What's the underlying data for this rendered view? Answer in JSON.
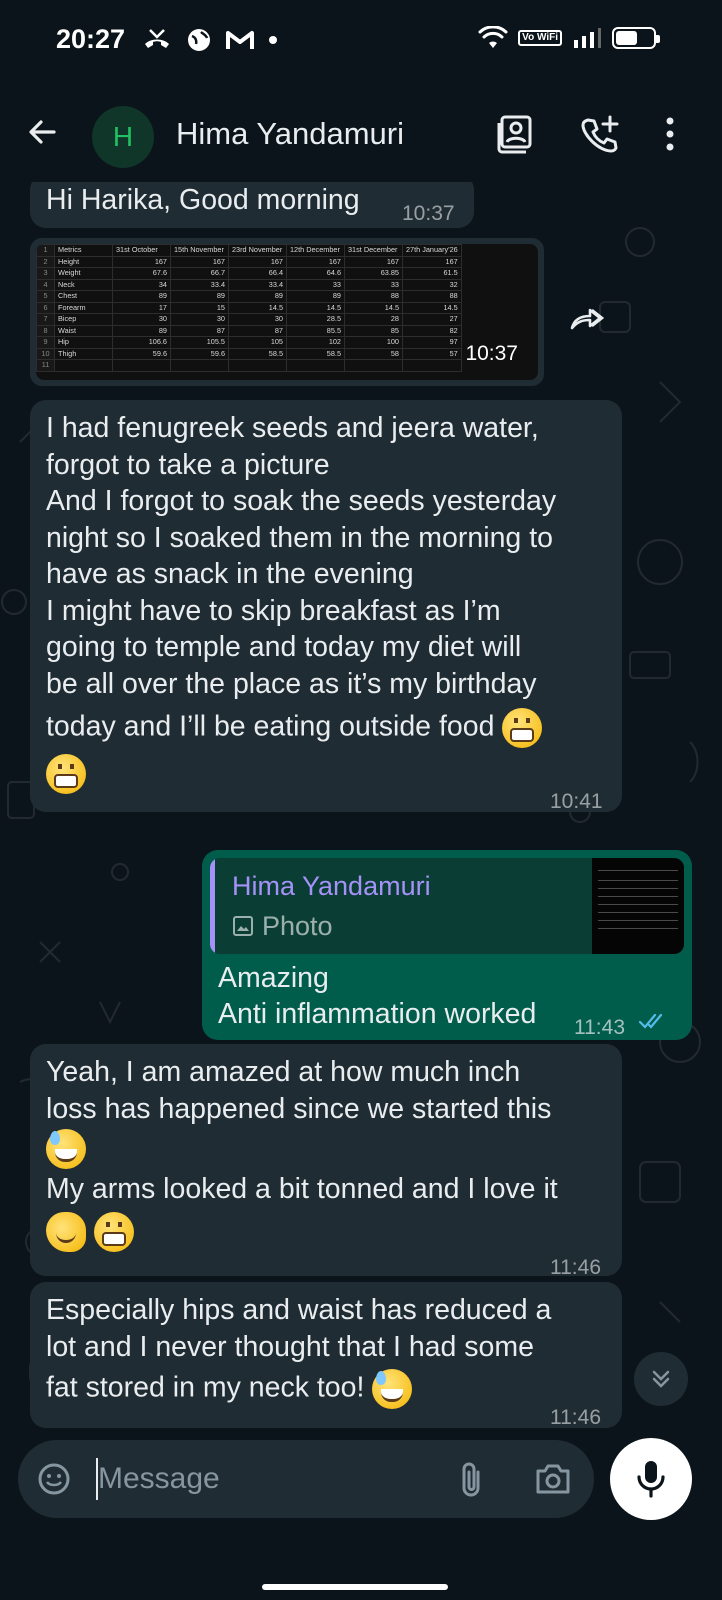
{
  "status_bar": {
    "time": "20:27",
    "network_badge": "Vo WiFi",
    "battery_level": 0.55
  },
  "header": {
    "avatar_letter": "H",
    "contact_name": "Hima Yandamuri"
  },
  "messages": [
    {
      "direction": "in",
      "text": "Hi Harika, Good morning",
      "time": "10:37"
    },
    {
      "direction": "in",
      "type": "image",
      "time": "10:37",
      "sheet": {
        "columns": [
          "",
          "Metrics",
          "31st October",
          "15th November",
          "23rd November",
          "12th December",
          "31st December",
          "27th January'26"
        ],
        "rows": [
          [
            "1",
            "Metrics",
            "31st October",
            "15th November",
            "23rd November",
            "12th December",
            "31st December",
            "27th January'26"
          ],
          [
            "2",
            "Height",
            "167",
            "167",
            "167",
            "167",
            "167",
            "167"
          ],
          [
            "3",
            "Weight",
            "67.6",
            "66.7",
            "66.4",
            "64.6",
            "63.85",
            "61.5"
          ],
          [
            "4",
            "Neck",
            "34",
            "33.4",
            "33.4",
            "33",
            "33",
            "32"
          ],
          [
            "5",
            "Chest",
            "89",
            "89",
            "89",
            "89",
            "88",
            "88"
          ],
          [
            "6",
            "Forearm",
            "17",
            "15",
            "14.5",
            "14.5",
            "14.5",
            "14.5"
          ],
          [
            "7",
            "Bicep",
            "30",
            "30",
            "30",
            "28.5",
            "28",
            "27"
          ],
          [
            "8",
            "Waist",
            "89",
            "87",
            "87",
            "85.5",
            "85",
            "82"
          ],
          [
            "9",
            "Hip",
            "106.6",
            "105.5",
            "105",
            "102",
            "100",
            "97"
          ],
          [
            "10",
            "Thigh",
            "59.6",
            "59.6",
            "58.5",
            "58.5",
            "58",
            "57"
          ],
          [
            "11",
            "",
            "",
            "",
            "",
            "",
            "",
            ""
          ]
        ]
      }
    },
    {
      "direction": "in",
      "lines": [
        "I had fenugreek seeds and jeera water,",
        "forgot to take a picture",
        "And I forgot to soak the seeds yesterday",
        "night so I soaked them in the morning to",
        "have as snack in the evening",
        "I might have to skip breakfast as I’m",
        "going to temple and today my diet will",
        "be all over the place as it’s my birthday",
        "today and I’ll be eating outside food"
      ],
      "emojis": [
        "grimacing-face",
        "grimacing-face"
      ],
      "time": "10:41"
    },
    {
      "direction": "out",
      "quote": {
        "name": "Hima Yandamuri",
        "type_label": "Photo"
      },
      "lines": [
        "Amazing",
        "Anti inflammation worked"
      ],
      "time": "11:43",
      "status": "read"
    },
    {
      "direction": "in",
      "lines": [
        "Yeah, I am amazed at how much inch",
        "loss has happened since we started this",
        "My arms looked a bit tonned and I love it"
      ],
      "emojis": [
        "sweat-smile-face",
        "melting-face",
        "grimacing-face"
      ],
      "time": "11:46"
    },
    {
      "direction": "in",
      "lines": [
        "Especially hips and waist has reduced a",
        "lot and I never thought that I had some",
        "fat stored in my neck too!"
      ],
      "emojis": [
        "sweat-smile-face"
      ],
      "time": "11:46"
    }
  ],
  "composer": {
    "placeholder": "Message"
  },
  "colors": {
    "background": "#0b141a",
    "incoming_bubble": "#202c33",
    "outgoing_bubble": "#005c4b",
    "quote_accent": "#a592f8",
    "read_ticks": "#53bdeb",
    "avatar_bg": "#103529",
    "avatar_fg": "#21c063"
  }
}
